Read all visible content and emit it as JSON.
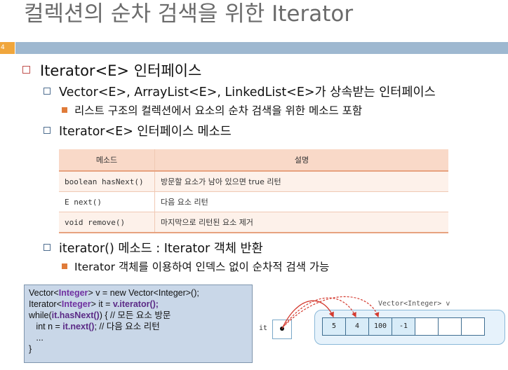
{
  "slide": {
    "title": "컬렉션의 순차 검색을 위한 Iterator",
    "number": "4",
    "colors": {
      "accent": "#f0a63c",
      "bar": "#9eb8d0",
      "bullet": "#c0504d"
    }
  },
  "bullets": {
    "l1": "Iterator<E> 인터페이스",
    "l2a": "Vector<E>, ArrayList<E>, LinkedList<E>가 상속받는 인터페이스",
    "l3a": "리스트 구조의 컬렉션에서 요소의 순차 검색을 위한 메소드 포함",
    "l2b": "Iterator<E> 인터페이스 메소드",
    "l2c": "iterator() 메소드 : Iterator 객체 반환",
    "l3c": "Iterator 객체를 이용하여 인덱스 없이 순차적 검색 가능"
  },
  "table": {
    "headers": [
      "메소드",
      "설명"
    ],
    "rows": [
      [
        "boolean hasNext()",
        "방문할 요소가 남아 있으면 true 리턴"
      ],
      [
        "E next()",
        "다음 요소 리턴"
      ],
      [
        "void remove()",
        "마지막으로 리턴된 요소 제거"
      ]
    ]
  },
  "code": {
    "l1a": "Vector<",
    "l1b": "Integer",
    "l1c": "> v = new Vector<Integer>();",
    "l2a": "Iterator<",
    "l2b": "Integer",
    "l2c": "> it = ",
    "l2d": "v.iterator();",
    "l3a": "while(",
    "l3b": "it.hasNext()",
    "l3c": ") { // 모든 요소 방문",
    "l4a": "   int n = ",
    "l4b": "it.next()",
    "l4c": "; // 다음 요소 리턴",
    "l5": "   ...",
    "l6": "}"
  },
  "diagram": {
    "vector_label": "Vector<Integer> v",
    "it_label": "it",
    "cells": [
      "5",
      "4",
      "100",
      "-1",
      "",
      "",
      ""
    ]
  }
}
